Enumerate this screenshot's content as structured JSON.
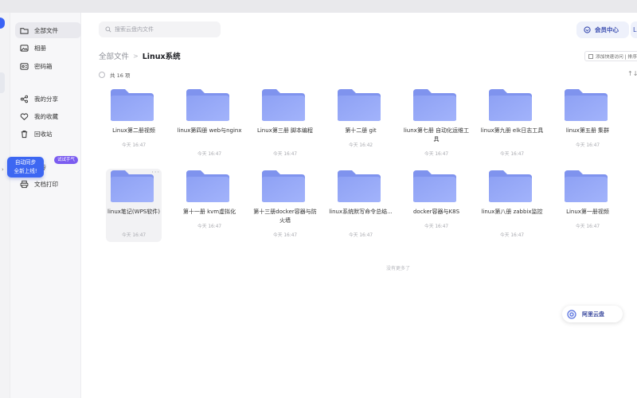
{
  "sidebar": {
    "items": [
      {
        "label": "全部文件",
        "icon": "folder-icon"
      },
      {
        "label": "相册",
        "icon": "photo-icon"
      },
      {
        "label": "密码箱",
        "icon": "safe-icon"
      },
      {
        "label": "我的分享",
        "icon": "share-icon"
      },
      {
        "label": "我的收藏",
        "icon": "heart-icon"
      },
      {
        "label": "回收站",
        "icon": "trash-icon"
      },
      {
        "label": "快传",
        "icon": "send-icon"
      },
      {
        "label": "文档打印",
        "icon": "printer-icon"
      }
    ],
    "sync_tip": {
      "title": "自动同步",
      "subtitle": "全新上线!"
    },
    "try_badge": "试试手气"
  },
  "search": {
    "placeholder": "搜索云盘内文件"
  },
  "header": {
    "vip_label": "会员中心",
    "user_label": "L"
  },
  "breadcrumb": {
    "root": "全部文件",
    "separator": ">",
    "current": "Linux系统"
  },
  "toolbar": {
    "quick_access": "添加快速访问 | 排序"
  },
  "list": {
    "count": "共 16 项",
    "sort_icon": "↑↓"
  },
  "files": [
    {
      "name": "Linux第二册视频",
      "time": "今天 16:47"
    },
    {
      "name": "linux第四册 web与nginx",
      "time": "今天 16:47"
    },
    {
      "name": "Linux第三册 脚本编程",
      "time": "今天 16:47"
    },
    {
      "name": "第十二册 git",
      "time": "今天 16:42"
    },
    {
      "name": "liunx第七册 自动化运维工具",
      "time": "今天 16:47"
    },
    {
      "name": "linux第九册 elk日志工具",
      "time": "今天 16:47"
    },
    {
      "name": "linux第五册 集群",
      "time": "今天 16:47"
    },
    {
      "name": "linux笔记(WPS软件)",
      "time": "今天 16:47"
    },
    {
      "name": "第十一册 kvm虚拟化",
      "time": "今天 16:47"
    },
    {
      "name": "第十三册docker容器与防火墙",
      "time": "今天 16:47"
    },
    {
      "name": "linux系统默写命令总结...",
      "time": "今天 16:47"
    },
    {
      "name": "docker容器与K8S",
      "time": "今天 16:47"
    },
    {
      "name": "linux第八册 zabbix监控",
      "time": "今天 16:47"
    },
    {
      "name": "Linux第一册视频",
      "time": "今天 16:47"
    }
  ],
  "end_text": "没有更多了",
  "float_button": {
    "label": "阿里云盘"
  },
  "colors": {
    "accent": "#3d67f2",
    "folder_top": "#8ea1f4",
    "folder_bottom": "#a2b3fb",
    "badge": "#7b5cf0"
  }
}
